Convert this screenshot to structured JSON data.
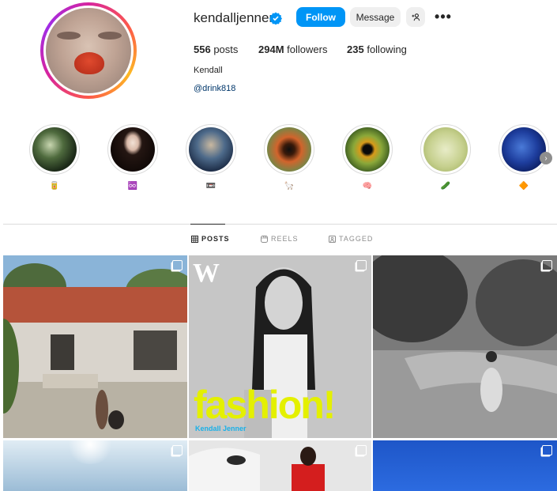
{
  "profile": {
    "username": "kendalljenner",
    "follow_label": "Follow",
    "message_label": "Message",
    "stats": {
      "posts_count": "556",
      "posts_label": "posts",
      "followers_count": "294M",
      "followers_label": "followers",
      "following_count": "235",
      "following_label": "following"
    },
    "full_name": "Kendall",
    "bio_link": "@drink818"
  },
  "highlights": [
    {
      "icon": "🥫"
    },
    {
      "icon": "♾️"
    },
    {
      "icon": "📼"
    },
    {
      "icon": "🦙"
    },
    {
      "icon": "🧠"
    },
    {
      "icon": "🥒"
    },
    {
      "icon": "🔶"
    }
  ],
  "tabs": [
    {
      "label": "POSTS"
    },
    {
      "label": "REELS"
    },
    {
      "label": "TAGGED"
    }
  ],
  "posts": [
    {
      "magazine_masthead": "W",
      "magazine_headline": "fashion!",
      "magazine_name": "Kendall Jenner"
    }
  ],
  "colors": {
    "accent": "#0095f6",
    "verified": "#0095f6",
    "link": "#00376b"
  }
}
